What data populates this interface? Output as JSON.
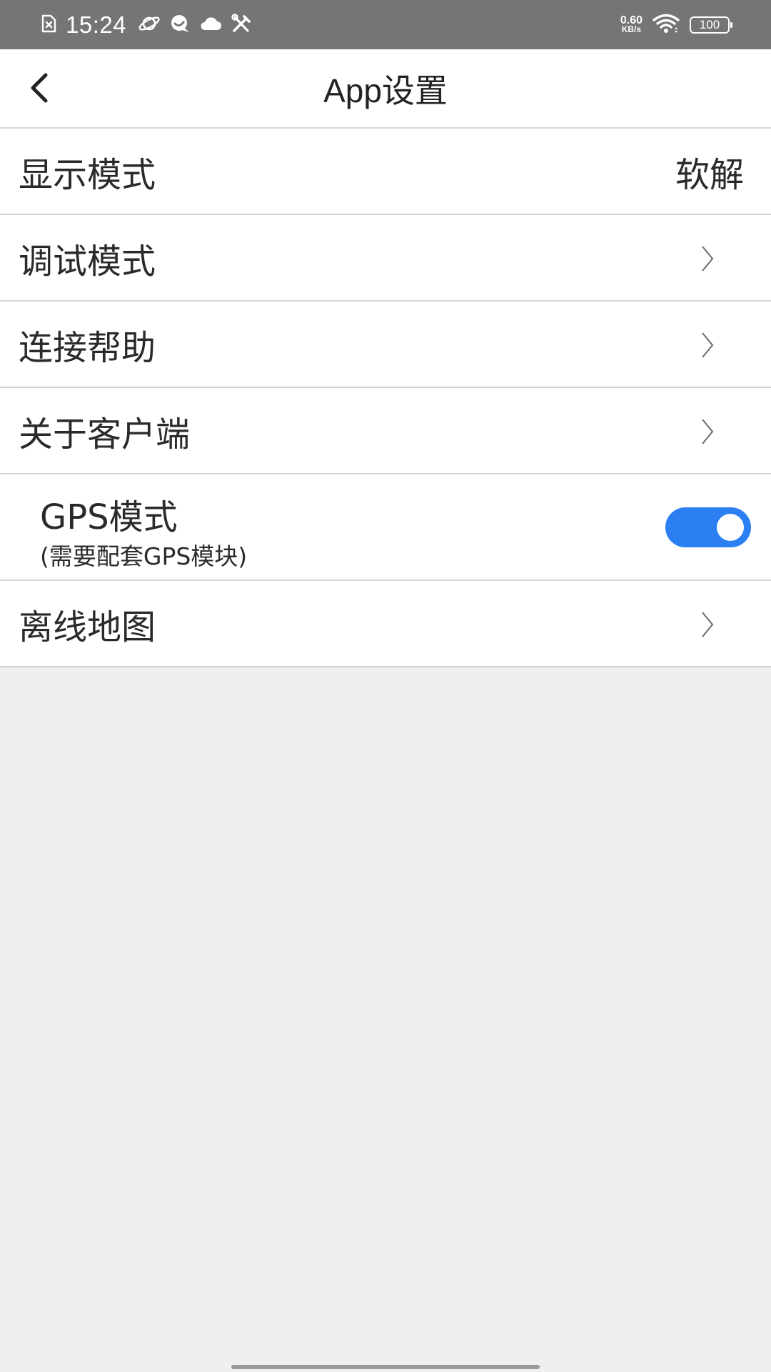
{
  "status_bar": {
    "time": "15:24",
    "net_speed_value": "0.60",
    "net_speed_unit": "KB/s",
    "battery": "100",
    "left_icons": [
      "sim-off-icon",
      "planet-icon",
      "chat-bubble-icon",
      "cloud-icon",
      "tools-icon"
    ],
    "right_icons": [
      "wifi-icon",
      "battery-icon"
    ]
  },
  "header": {
    "title": "App设置"
  },
  "settings": {
    "display_mode": {
      "label": "显示模式",
      "value": "软解"
    },
    "debug_mode": {
      "label": "调试模式"
    },
    "connect_help": {
      "label": "连接帮助"
    },
    "about_client": {
      "label": "关于客户端"
    },
    "gps_mode": {
      "label": "GPS模式",
      "sublabel": "(需要配套GPS模块)",
      "enabled": true
    },
    "offline_map": {
      "label": "离线地图"
    }
  },
  "colors": {
    "status_bar": "#757575",
    "accent": "#2b7ff3",
    "background": "#efefef",
    "row_background": "#ffffff",
    "divider": "#d4d4d4"
  }
}
